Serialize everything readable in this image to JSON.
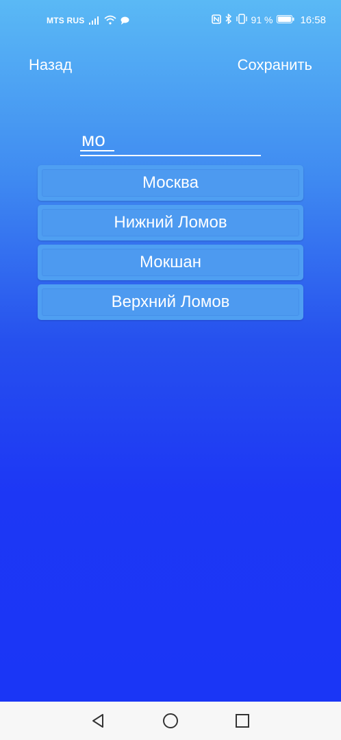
{
  "status_bar": {
    "carrier": "MTS RUS",
    "battery_percent": "91 %",
    "time": "16:58",
    "icons": [
      "signal-icon",
      "wifi-icon",
      "message-icon",
      "nfc-icon",
      "bluetooth-icon",
      "vibrate-icon",
      "battery-icon"
    ]
  },
  "header": {
    "back_label": "Назад",
    "save_label": "Сохранить"
  },
  "search": {
    "value": "мо",
    "placeholder": ""
  },
  "results": [
    {
      "label": "Москва"
    },
    {
      "label": "Нижний Ломов"
    },
    {
      "label": "Мокшан"
    },
    {
      "label": "Верхний Ломов"
    }
  ],
  "nav_bar": {
    "icons": [
      "back-triangle-icon",
      "home-circle-icon",
      "recents-square-icon"
    ]
  },
  "colors": {
    "gradient_top": "#5ab9f5",
    "gradient_bottom": "#1a36f6",
    "item_bg": "#4f9ff2",
    "text": "#ffffff",
    "nav_bg": "#f7f7f7"
  }
}
